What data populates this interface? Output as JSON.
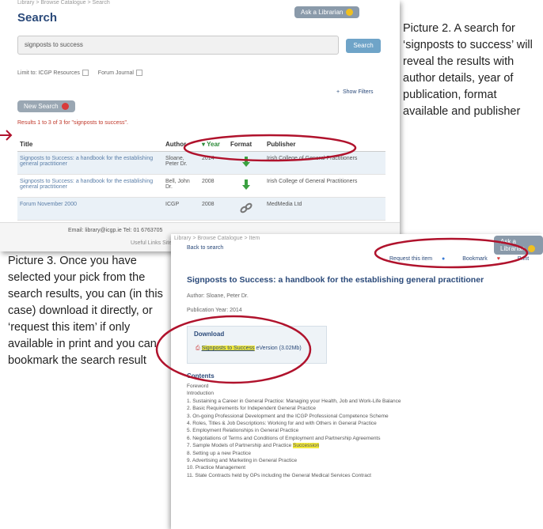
{
  "shot1": {
    "breadcrumb": "Library > Browse Catalogue > Search",
    "title": "Search",
    "ask_librarian": "Ask a Librarian",
    "search_value": "signposts to success",
    "search_button": "Search",
    "limit_label": "Limit to: ICGP Resources",
    "forum_label": "Forum Journal",
    "show_filters": "Show Filters",
    "new_search": "New Search",
    "results_text": "Results 1 to 3 of 3 for \"signposts to success\".",
    "columns": [
      "Title",
      "Author",
      "Year",
      "Format",
      "Publisher"
    ],
    "rows": [
      {
        "title": "Signposts to Success: a handbook for the establishing general practitioner",
        "author": "Sloane, Peter Dr.",
        "year": "2014",
        "format": "download",
        "publisher": "Irish College of General Practitioners"
      },
      {
        "title": "Signposts to Success: a handbook for the establishing general practitioner",
        "author": "Bell, John Dr.",
        "year": "2008",
        "format": "download",
        "publisher": "Irish College of General Practitioners"
      },
      {
        "title": "Forum November 2000",
        "author": "ICGP",
        "year": "2008",
        "format": "link",
        "publisher": "MedMedia Ltd"
      }
    ],
    "footer_email": "Email: library@icgp.ie   Tel: 01 6763705",
    "footer_links": "Useful Links   Site M..."
  },
  "caption2": "Picture 2. A search for ‘signposts to success’ will reveal the results with author details, year of publication, format available and publisher",
  "caption3": "Picture 3. Once you have selected your pick from the search results, you can (in this case) download it directly, or ‘request this item’ if only available in print and you can bookmark the search result",
  "shot2": {
    "breadcrumb": "Library > Browse Catalogue > Item",
    "back_to_search": "Back to search",
    "ask_librarian": "Ask a Librarian",
    "request_item": "Request this item",
    "bookmark": "Bookmark",
    "print": "Print",
    "title": "Signposts to Success: a handbook for the establishing general practitioner",
    "author": "Author: Sloane, Peter Dr.",
    "publication_year": "Publication Year: 2014",
    "download_heading": "Download",
    "download_link": "Signposts to Success",
    "download_link_suffix": "eVersion (3.02Mb)",
    "contents_heading": "Contents",
    "toc": [
      "Foreword",
      "Introduction",
      "1. Sustaining a Career in General Practice: Managing your Health, Job and Work-Life Balance",
      "2. Basic Requirements for Independent General Practice",
      "3. On-going Professional Development and the ICGP Professional Competence Scheme",
      "4. Roles, Titles & Job Descriptions: Working for and with Others in General Practice",
      "5. Employment Relationships in General Practice",
      "6. Negotiations of Terms and Conditions of Employment and Partnership Agreements",
      "7. Sample Models of Partnership and Practice Succession",
      "8. Setting up a new Practice",
      "9. Advertising and Marketing in General Practice",
      "10. Practice Management",
      "11. State Contracts held by GPs including the General Medical Services Contract"
    ]
  },
  "colors": {
    "heading": "#2b4a7a",
    "ellipse": "#b0122c",
    "highlight": "#f3ea3c",
    "link": "#5a7ea8"
  }
}
